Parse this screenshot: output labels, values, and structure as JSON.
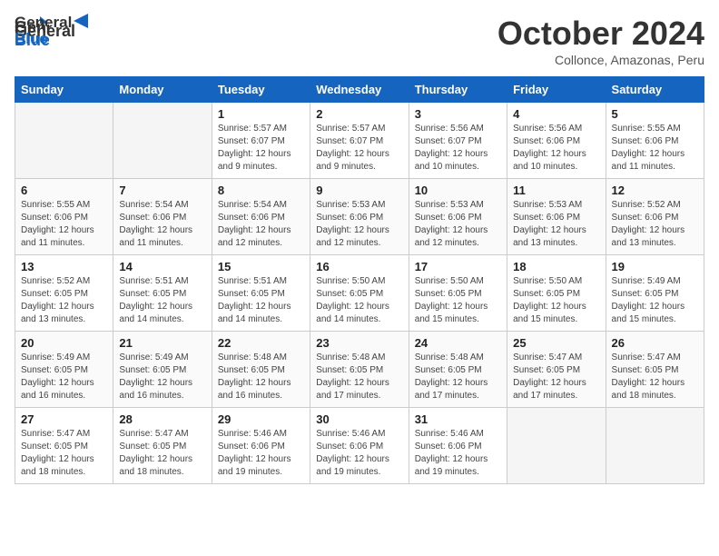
{
  "logo": {
    "general": "General",
    "blue": "Blue"
  },
  "title": "October 2024",
  "subtitle": "Collonce, Amazonas, Peru",
  "weekdays": [
    "Sunday",
    "Monday",
    "Tuesday",
    "Wednesday",
    "Thursday",
    "Friday",
    "Saturday"
  ],
  "weeks": [
    [
      {
        "day": "",
        "sunrise": "",
        "sunset": "",
        "daylight": ""
      },
      {
        "day": "",
        "sunrise": "",
        "sunset": "",
        "daylight": ""
      },
      {
        "day": "1",
        "sunrise": "Sunrise: 5:57 AM",
        "sunset": "Sunset: 6:07 PM",
        "daylight": "Daylight: 12 hours and 9 minutes."
      },
      {
        "day": "2",
        "sunrise": "Sunrise: 5:57 AM",
        "sunset": "Sunset: 6:07 PM",
        "daylight": "Daylight: 12 hours and 9 minutes."
      },
      {
        "day": "3",
        "sunrise": "Sunrise: 5:56 AM",
        "sunset": "Sunset: 6:07 PM",
        "daylight": "Daylight: 12 hours and 10 minutes."
      },
      {
        "day": "4",
        "sunrise": "Sunrise: 5:56 AM",
        "sunset": "Sunset: 6:06 PM",
        "daylight": "Daylight: 12 hours and 10 minutes."
      },
      {
        "day": "5",
        "sunrise": "Sunrise: 5:55 AM",
        "sunset": "Sunset: 6:06 PM",
        "daylight": "Daylight: 12 hours and 11 minutes."
      }
    ],
    [
      {
        "day": "6",
        "sunrise": "Sunrise: 5:55 AM",
        "sunset": "Sunset: 6:06 PM",
        "daylight": "Daylight: 12 hours and 11 minutes."
      },
      {
        "day": "7",
        "sunrise": "Sunrise: 5:54 AM",
        "sunset": "Sunset: 6:06 PM",
        "daylight": "Daylight: 12 hours and 11 minutes."
      },
      {
        "day": "8",
        "sunrise": "Sunrise: 5:54 AM",
        "sunset": "Sunset: 6:06 PM",
        "daylight": "Daylight: 12 hours and 12 minutes."
      },
      {
        "day": "9",
        "sunrise": "Sunrise: 5:53 AM",
        "sunset": "Sunset: 6:06 PM",
        "daylight": "Daylight: 12 hours and 12 minutes."
      },
      {
        "day": "10",
        "sunrise": "Sunrise: 5:53 AM",
        "sunset": "Sunset: 6:06 PM",
        "daylight": "Daylight: 12 hours and 12 minutes."
      },
      {
        "day": "11",
        "sunrise": "Sunrise: 5:53 AM",
        "sunset": "Sunset: 6:06 PM",
        "daylight": "Daylight: 12 hours and 13 minutes."
      },
      {
        "day": "12",
        "sunrise": "Sunrise: 5:52 AM",
        "sunset": "Sunset: 6:06 PM",
        "daylight": "Daylight: 12 hours and 13 minutes."
      }
    ],
    [
      {
        "day": "13",
        "sunrise": "Sunrise: 5:52 AM",
        "sunset": "Sunset: 6:05 PM",
        "daylight": "Daylight: 12 hours and 13 minutes."
      },
      {
        "day": "14",
        "sunrise": "Sunrise: 5:51 AM",
        "sunset": "Sunset: 6:05 PM",
        "daylight": "Daylight: 12 hours and 14 minutes."
      },
      {
        "day": "15",
        "sunrise": "Sunrise: 5:51 AM",
        "sunset": "Sunset: 6:05 PM",
        "daylight": "Daylight: 12 hours and 14 minutes."
      },
      {
        "day": "16",
        "sunrise": "Sunrise: 5:50 AM",
        "sunset": "Sunset: 6:05 PM",
        "daylight": "Daylight: 12 hours and 14 minutes."
      },
      {
        "day": "17",
        "sunrise": "Sunrise: 5:50 AM",
        "sunset": "Sunset: 6:05 PM",
        "daylight": "Daylight: 12 hours and 15 minutes."
      },
      {
        "day": "18",
        "sunrise": "Sunrise: 5:50 AM",
        "sunset": "Sunset: 6:05 PM",
        "daylight": "Daylight: 12 hours and 15 minutes."
      },
      {
        "day": "19",
        "sunrise": "Sunrise: 5:49 AM",
        "sunset": "Sunset: 6:05 PM",
        "daylight": "Daylight: 12 hours and 15 minutes."
      }
    ],
    [
      {
        "day": "20",
        "sunrise": "Sunrise: 5:49 AM",
        "sunset": "Sunset: 6:05 PM",
        "daylight": "Daylight: 12 hours and 16 minutes."
      },
      {
        "day": "21",
        "sunrise": "Sunrise: 5:49 AM",
        "sunset": "Sunset: 6:05 PM",
        "daylight": "Daylight: 12 hours and 16 minutes."
      },
      {
        "day": "22",
        "sunrise": "Sunrise: 5:48 AM",
        "sunset": "Sunset: 6:05 PM",
        "daylight": "Daylight: 12 hours and 16 minutes."
      },
      {
        "day": "23",
        "sunrise": "Sunrise: 5:48 AM",
        "sunset": "Sunset: 6:05 PM",
        "daylight": "Daylight: 12 hours and 17 minutes."
      },
      {
        "day": "24",
        "sunrise": "Sunrise: 5:48 AM",
        "sunset": "Sunset: 6:05 PM",
        "daylight": "Daylight: 12 hours and 17 minutes."
      },
      {
        "day": "25",
        "sunrise": "Sunrise: 5:47 AM",
        "sunset": "Sunset: 6:05 PM",
        "daylight": "Daylight: 12 hours and 17 minutes."
      },
      {
        "day": "26",
        "sunrise": "Sunrise: 5:47 AM",
        "sunset": "Sunset: 6:05 PM",
        "daylight": "Daylight: 12 hours and 18 minutes."
      }
    ],
    [
      {
        "day": "27",
        "sunrise": "Sunrise: 5:47 AM",
        "sunset": "Sunset: 6:05 PM",
        "daylight": "Daylight: 12 hours and 18 minutes."
      },
      {
        "day": "28",
        "sunrise": "Sunrise: 5:47 AM",
        "sunset": "Sunset: 6:05 PM",
        "daylight": "Daylight: 12 hours and 18 minutes."
      },
      {
        "day": "29",
        "sunrise": "Sunrise: 5:46 AM",
        "sunset": "Sunset: 6:06 PM",
        "daylight": "Daylight: 12 hours and 19 minutes."
      },
      {
        "day": "30",
        "sunrise": "Sunrise: 5:46 AM",
        "sunset": "Sunset: 6:06 PM",
        "daylight": "Daylight: 12 hours and 19 minutes."
      },
      {
        "day": "31",
        "sunrise": "Sunrise: 5:46 AM",
        "sunset": "Sunset: 6:06 PM",
        "daylight": "Daylight: 12 hours and 19 minutes."
      },
      {
        "day": "",
        "sunrise": "",
        "sunset": "",
        "daylight": ""
      },
      {
        "day": "",
        "sunrise": "",
        "sunset": "",
        "daylight": ""
      }
    ]
  ]
}
